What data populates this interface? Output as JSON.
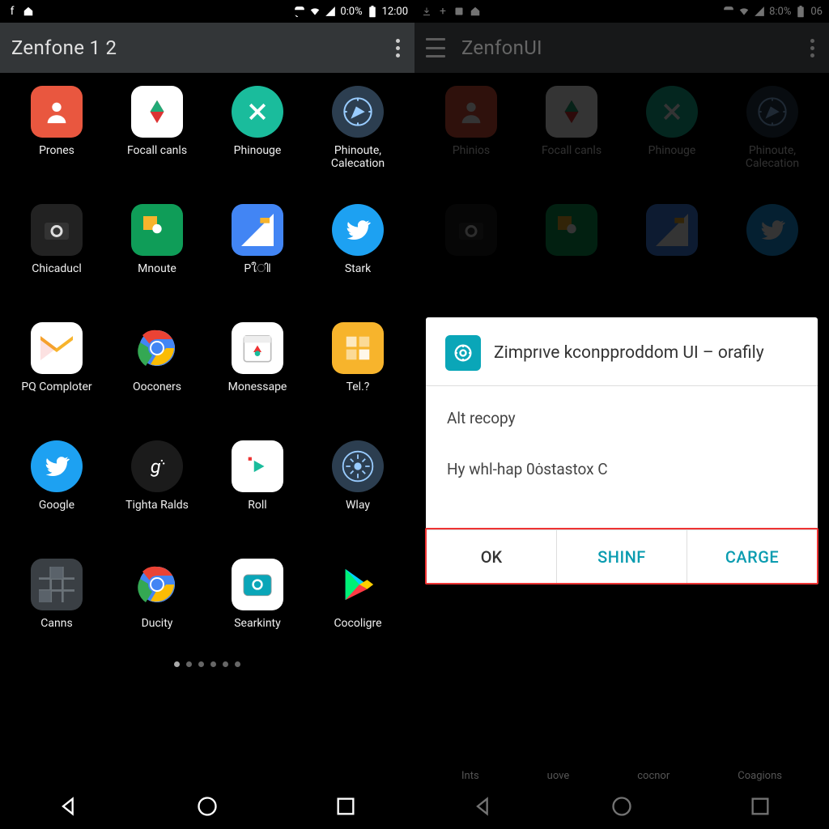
{
  "left": {
    "status": {
      "left_icons": [
        "f",
        "home"
      ],
      "battery_pct": "0:0%",
      "time": "12:00"
    },
    "header": {
      "title": "Zenfone 1 2",
      "show_hamburger": false
    },
    "apps": [
      {
        "label": "Prones",
        "icon": "person",
        "bg": "#e9573f",
        "round": false
      },
      {
        "label": "Focall canls",
        "icon": "leaf",
        "bg": "#ffffff",
        "round": false,
        "fg": "#d33"
      },
      {
        "label": "Phinouge",
        "icon": "x",
        "bg": "#1abc9c",
        "round": true
      },
      {
        "label": "Phinoute, Calecation",
        "icon": "compass",
        "bg": "#2c3e50",
        "round": true
      },
      {
        "label": "Chicaducl",
        "icon": "camera",
        "bg": "#222",
        "round": false
      },
      {
        "label": "Mnoute",
        "icon": "pin",
        "bg": "#0f9d58",
        "round": false
      },
      {
        "label": "Pใിl",
        "icon": "tri",
        "bg": "#4285f4",
        "round": false
      },
      {
        "label": "Stark",
        "icon": "twitter",
        "bg": "#1da1f2",
        "round": true
      },
      {
        "label": "PQ Comploter",
        "icon": "mail",
        "bg": "#ffffff",
        "round": false
      },
      {
        "label": "Ooconers",
        "icon": "chrome",
        "bg": "",
        "round": true
      },
      {
        "label": "Monessape",
        "icon": "cal",
        "bg": "#ffffff",
        "round": false
      },
      {
        "label": "Tel.?",
        "icon": "tiles",
        "bg": "#f7b42c",
        "round": false
      },
      {
        "label": "Google",
        "icon": "twitter",
        "bg": "#1da1f2",
        "round": true
      },
      {
        "label": "Tighta Ralds",
        "icon": "g",
        "bg": "#1b1b1b",
        "round": true
      },
      {
        "label": "Roll",
        "icon": "play",
        "bg": "#ffffff",
        "round": false
      },
      {
        "label": "Wlay",
        "icon": "dial",
        "bg": "#2c3e50",
        "round": true
      },
      {
        "label": "Canns",
        "icon": "grid",
        "bg": "#3a3f44",
        "round": false
      },
      {
        "label": "Ducity",
        "icon": "chrome",
        "bg": "",
        "round": true
      },
      {
        "label": "Searkinty",
        "icon": "cam2",
        "bg": "#ffffff",
        "round": false
      },
      {
        "label": "Cocoligre",
        "icon": "playstore",
        "bg": "",
        "round": false
      }
    ],
    "page_dots": 6,
    "page_active": 0
  },
  "right": {
    "status": {
      "left_icons": [
        "dl",
        "plus",
        "sq",
        "home"
      ],
      "battery_pct": "8:0%",
      "time": "06"
    },
    "header": {
      "title": "ZenfonUI",
      "show_hamburger": true
    },
    "apps": [
      {
        "label": "Phinios",
        "icon": "person",
        "bg": "#e9573f",
        "round": false
      },
      {
        "label": "Focall canls",
        "icon": "leaf",
        "bg": "#ffffff",
        "round": false
      },
      {
        "label": "Phinouge",
        "icon": "x",
        "bg": "#1abc9c",
        "round": true
      },
      {
        "label": "Phinoute, Calecation",
        "icon": "compass",
        "bg": "#2c3e50",
        "round": true
      },
      {
        "label": "",
        "icon": "camera",
        "bg": "#222",
        "round": false
      },
      {
        "label": "",
        "icon": "pin",
        "bg": "#0f9d58",
        "round": false
      },
      {
        "label": "",
        "icon": "tri",
        "bg": "#4285f4",
        "round": false
      },
      {
        "label": "",
        "icon": "twitter",
        "bg": "#1da1f2",
        "round": true
      }
    ],
    "dialog": {
      "title": "Zimprıve kconpproddom UI  – orafily",
      "line1": "Alt recopy",
      "line2": "Hy whl-hap 0ȯstastox C",
      "buttons": {
        "ok": "OK",
        "b2": "SHINF",
        "b3": "CARGE"
      }
    },
    "dim_labels": [
      "Ints",
      "uove",
      "cocnor",
      "Coagions"
    ]
  }
}
